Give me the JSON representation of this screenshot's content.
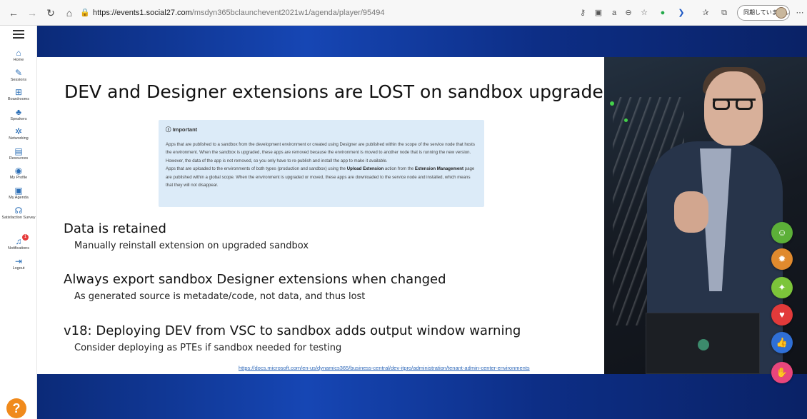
{
  "browser": {
    "url_host": "https://events1.social27.com",
    "url_path": "/msdyn365bclaunchevent2021w1/agenda/player/95494",
    "profile_label": "同期していません"
  },
  "sidebar": {
    "items": [
      {
        "label": "Home",
        "icon": "home-icon"
      },
      {
        "label": "Sessions",
        "icon": "pencil-icon"
      },
      {
        "label": "Boardrooms",
        "icon": "boardroom-icon"
      },
      {
        "label": "Speakers",
        "icon": "speaker-icon"
      },
      {
        "label": "Networking",
        "icon": "network-icon"
      },
      {
        "label": "Resources",
        "icon": "resources-icon"
      },
      {
        "label": "My Profile",
        "icon": "profile-icon"
      },
      {
        "label": "My Agenda",
        "icon": "agenda-icon"
      },
      {
        "label": "Satisfaction Survey",
        "icon": "survey-icon"
      },
      {
        "label": "Notifications",
        "icon": "bell-icon",
        "badge": "1"
      },
      {
        "label": "Logout",
        "icon": "logout-icon"
      }
    ],
    "help_label": "?"
  },
  "slide": {
    "title": "DEV and Designer extensions are LOST on sandbox upgrade",
    "note_heading": "Important",
    "note_p1": "Apps that are published to a sandbox from the development environment or created using Designer are published within the scope of the service node that hosts the environment. When the sandbox is upgraded, these apps are removed because the environment is moved to another node that is running the new version. However, the data of the app is not removed, so you only have to re-publish and install the app to make it available.",
    "note_p2_a": "Apps that are uploaded to the environments of both types (production and sandbox) using the ",
    "note_p2_b": "Upload Extension",
    "note_p2_c": " action from the ",
    "note_p2_d": "Extension Management",
    "note_p2_e": " page are published within a global scope. When the environment is upgraded or moved, these apps are downloaded to the service node and installed, which means that they will not disappear.",
    "points": [
      {
        "heading": "Data is retained",
        "sub": "Manually reinstall extension on upgraded sandbox"
      },
      {
        "heading": "Always export sandbox Designer extensions when changed",
        "sub": "As generated source is metadate/code, not data, and thus lost"
      },
      {
        "heading": "v18: Deploying DEV from VSC to sandbox adds output window warning",
        "sub": "Consider deploying as PTEs if sandbox needed for testing"
      }
    ],
    "link": "https://docs.microsoft.com/en-us/dynamics365/business-central/dev-itpro/administration/tenant-admin-center-environments"
  },
  "reactions": [
    {
      "name": "smile",
      "color": "#5cb038",
      "glyph": "☺"
    },
    {
      "name": "idea",
      "color": "#e08a2e",
      "glyph": "✹"
    },
    {
      "name": "celebrate",
      "color": "#7cc53a",
      "glyph": "✦"
    },
    {
      "name": "heart",
      "color": "#e23a3a",
      "glyph": "♥"
    },
    {
      "name": "like",
      "color": "#2f6fd6",
      "glyph": "👍"
    },
    {
      "name": "clap",
      "color": "#e8467c",
      "glyph": "✋"
    }
  ]
}
